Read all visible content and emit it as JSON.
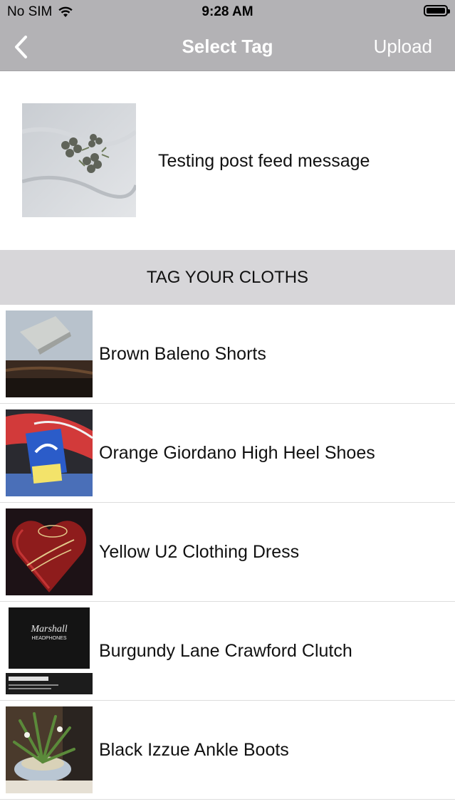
{
  "status_bar": {
    "carrier": "No SIM",
    "time": "9:28 AM"
  },
  "navbar": {
    "title": "Select Tag",
    "upload_label": "Upload",
    "back_icon": "chevron-left-icon"
  },
  "post": {
    "message": "Testing post feed message"
  },
  "section": {
    "title": "TAG YOUR CLOTHS"
  },
  "items": [
    {
      "label": "Brown Baleno Shorts"
    },
    {
      "label": "Orange Giordano High Heel Shoes"
    },
    {
      "label": "Yellow U2 Clothing Dress"
    },
    {
      "label": "Burgundy Lane Crawford Clutch"
    },
    {
      "label": "Black Izzue Ankle Boots"
    }
  ],
  "colors": {
    "bar": "#b3b2b5",
    "section": "#d7d6d9"
  }
}
